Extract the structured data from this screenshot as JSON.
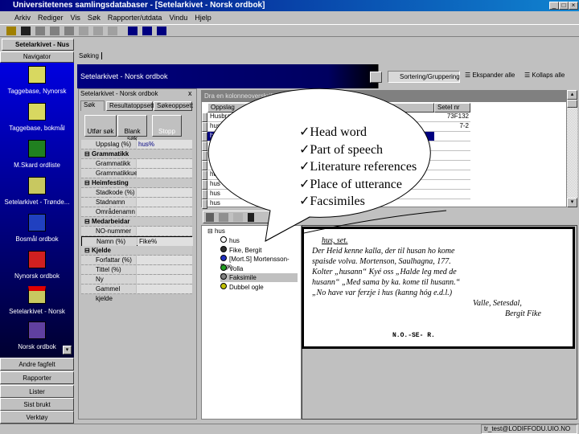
{
  "window": {
    "title": "Universitetenes samlingsdatabaser - [Setelarkivet - Norsk ordbok]"
  },
  "menu": [
    "Arkiv",
    "Rediger",
    "Vis",
    "Søk",
    "Rapporter/utdata",
    "Vindu",
    "Hjelp"
  ],
  "mdi_tab": "Setelarkivet - Nus",
  "navigator": {
    "header": "Navigator",
    "items": [
      "Taggebase, Nynorsk",
      "Taggebase, bokmål",
      "M.Skard ordliste",
      "Setelarkivet - Trønde...",
      "Bosmål ordbok",
      "Nynorsk ordbok",
      "Setelarkivet - Norsk",
      "Norsk ordbok"
    ],
    "buttons": [
      "Andre fagfelt",
      "Rapporter",
      "Lister",
      "Sist brukt",
      "Verktøy"
    ]
  },
  "search_tab": "Søking",
  "band_title": "Setelarkivet - Norsk ordbok",
  "band_toolbar": {
    "sort": "Sortering/Gruppering",
    "expand": "Ekspander alle",
    "collapse": "Kollaps alle"
  },
  "search_panel": {
    "title": "Setelarkivet - Norsk ordbok",
    "close": "x",
    "tabs": [
      "Søk",
      "Resultatoppsett",
      "Søkeoppsett"
    ],
    "buttons": [
      "Utfør søk",
      "Blank søk",
      "Stopp"
    ],
    "rows": [
      {
        "type": "field",
        "label": "Uppslag (%)",
        "value": "hus%"
      },
      {
        "type": "cat",
        "label": "Grammatikk"
      },
      {
        "type": "field",
        "label": "Grammatikk (%",
        "value": ""
      },
      {
        "type": "field",
        "label": "Grammatikkue",
        "value": ""
      },
      {
        "type": "cat",
        "label": "Heimfesting"
      },
      {
        "type": "field",
        "label": "Stadkode (%)",
        "value": ""
      },
      {
        "type": "field",
        "label": "Stadnamn (%)",
        "value": ""
      },
      {
        "type": "field",
        "label": "Områdenamn",
        "value": ""
      },
      {
        "type": "cat",
        "label": "Medarbeidar"
      },
      {
        "type": "field",
        "label": "NO-nummer",
        "value": ""
      },
      {
        "type": "field",
        "label": "Namn (%)",
        "value": "Fike%"
      },
      {
        "type": "cat",
        "label": "Kjelde"
      },
      {
        "type": "field",
        "label": "Forfattar (%)",
        "value": ""
      },
      {
        "type": "field",
        "label": "Tittel (%)",
        "value": ""
      },
      {
        "type": "field",
        "label": "Ny kjeldeavsty",
        "value": ""
      },
      {
        "type": "field",
        "label": "Gammel kjelde",
        "value": ""
      }
    ]
  },
  "results": {
    "group_hint": "Dra en kolonneoverskrift hit for å gruppere",
    "columns": [
      "Oppslag",
      "Setel nr"
    ],
    "rows": [
      [
        "Husbra",
        "73F132"
      ],
      [
        "hus",
        "7-2"
      ],
      [
        "hus",
        ""
      ],
      [
        "hus",
        ""
      ],
      [
        "hus",
        ""
      ],
      [
        "hus",
        ""
      ],
      [
        "hus",
        ""
      ],
      [
        "hus",
        ""
      ],
      [
        "hus",
        ""
      ],
      [
        "hus",
        ""
      ]
    ]
  },
  "tree": {
    "root": "hus",
    "children": [
      "hus",
      "Fike, Bergit",
      "[Mort.S] Mortensson-Egn",
      "Volla",
      "Faksimile",
      "Dubbel ogle"
    ],
    "selected": "Faksimile"
  },
  "facsimile": {
    "stamp": "N.O.-SE- R.",
    "lines": [
      "hus, set.",
      "Der Heid kenne kalla, der til husan ho kome",
      "spaisde volva. Mortenson, Saulhagna, 177.",
      "Kolter „husann“ Kyé oss „Halde leg med de",
      "husann“ „Med sama by ka. kome til husann.“",
      "„No have var ferzje i hus (kanng hóg e.d.l.)",
      "Valle, Setesdal,",
      "Bergit Fike"
    ]
  },
  "callout": {
    "items": [
      "Head word",
      "Part of speech",
      "Literature references",
      "Place of utterance",
      "Facsimiles"
    ],
    "check": "ü"
  },
  "status": {
    "user": "tr_test@LODIFFODU.UIO.NO"
  }
}
